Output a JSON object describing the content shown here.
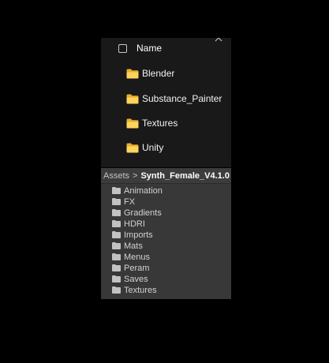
{
  "explorer": {
    "header": {
      "label": "Name",
      "checked": false,
      "sort_icon": "chevron-up-icon"
    },
    "folder_icon": "folder-icon",
    "folder_color": "#f5c542",
    "items": [
      {
        "label": "Blender"
      },
      {
        "label": "Substance_Painter"
      },
      {
        "label": "Textures"
      },
      {
        "label": "Unity"
      }
    ]
  },
  "project": {
    "breadcrumb": {
      "root": "Assets",
      "separator": ">",
      "current": "Synth_Female_V4.1.0"
    },
    "folder_icon": "folder-icon",
    "folder_color": "#c2c2c2",
    "items": [
      {
        "label": "Animation"
      },
      {
        "label": "FX"
      },
      {
        "label": "Gradients"
      },
      {
        "label": "HDRI"
      },
      {
        "label": "Imports"
      },
      {
        "label": "Mats"
      },
      {
        "label": "Menus"
      },
      {
        "label": "Peram"
      },
      {
        "label": "Saves"
      },
      {
        "label": "Textures"
      }
    ]
  }
}
